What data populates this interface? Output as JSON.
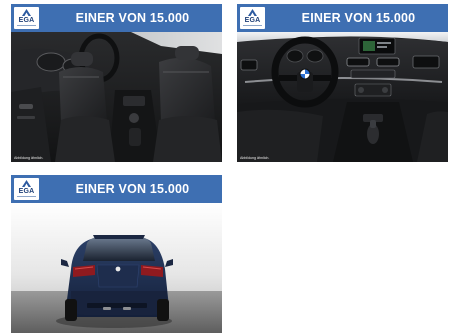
{
  "listings": [
    {
      "logo_text": "EGA",
      "headline": "EINER VON 15.000",
      "caption": "Abbildung ähnlich.",
      "photo_subject": "car-interior-seats"
    },
    {
      "logo_text": "EGA",
      "headline": "EINER VON 15.000",
      "caption": "Abbildung ähnlich.",
      "photo_subject": "car-interior-dashboard"
    },
    {
      "logo_text": "EGA",
      "headline": "EINER VON 15.000",
      "caption": "",
      "photo_subject": "car-exterior-rear"
    }
  ],
  "colors": {
    "banner": "#3e6fb2",
    "logo_text": "#1e3f77",
    "car_body": "#1d2c4c"
  }
}
